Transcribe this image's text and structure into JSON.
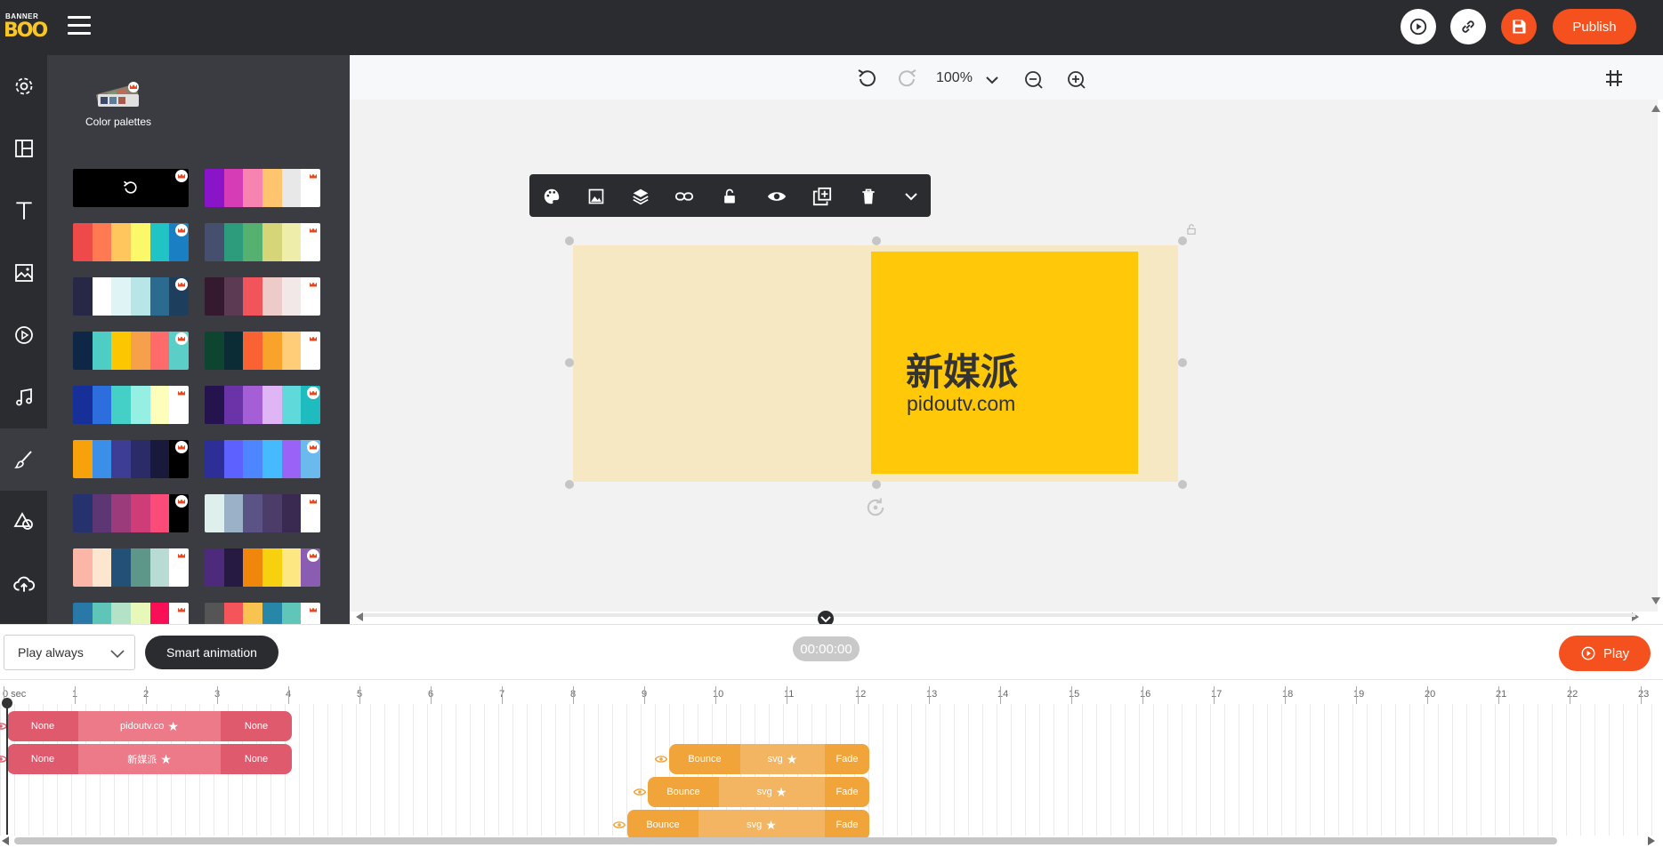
{
  "app": {
    "logo_top": "BANNER",
    "logo_bottom": "BOO",
    "publish_label": "Publish"
  },
  "panel": {
    "title": "Color palettes",
    "palettes": [
      {
        "colors": [
          "#000000"
        ],
        "is_reset": true
      },
      {
        "colors": [
          "#8a14c8",
          "#d63cb5",
          "#f783b0",
          "#ffc46e",
          "#e8e8e8",
          "#ffffff"
        ]
      },
      {
        "colors": [
          "#ef4a4a",
          "#ff7a52",
          "#ffc65d",
          "#fbf86a",
          "#21c4c4",
          "#1b7fc4"
        ]
      },
      {
        "colors": [
          "#464f6e",
          "#2c9c7d",
          "#56b06f",
          "#d6d679",
          "#eeeeaa",
          "#ffffff"
        ]
      },
      {
        "colors": [
          "#272845",
          "#ffffff",
          "#dff4f5",
          "#b8e5e8",
          "#2a6b8f",
          "#1d3e5c"
        ]
      },
      {
        "colors": [
          "#34192f",
          "#5d3a53",
          "#f2545b",
          "#edcbc9",
          "#f3e8e8",
          "#ffffff"
        ]
      },
      {
        "colors": [
          "#0f2747",
          "#4ecdc4",
          "#fcc600",
          "#f7a04b",
          "#ff6b6b",
          "#5bcec7"
        ]
      },
      {
        "colors": [
          "#0e4530",
          "#0b2c35",
          "#fa6234",
          "#f9a32a",
          "#ffcc77",
          "#ffffff"
        ]
      },
      {
        "colors": [
          "#172f98",
          "#2d6ede",
          "#45d0c7",
          "#95efe3",
          "#fdfeb9",
          "#ffffff"
        ]
      },
      {
        "colors": [
          "#24134d",
          "#6a34a8",
          "#a45fd7",
          "#e0b5f5",
          "#5fd9da",
          "#1fbcbf"
        ]
      },
      {
        "colors": [
          "#f7a10b",
          "#3c8fe8",
          "#3d3d94",
          "#2b2b68",
          "#19193b",
          "#000000"
        ]
      },
      {
        "colors": [
          "#2e2f96",
          "#5c61ff",
          "#4d86ff",
          "#45bbfe",
          "#9a62f7",
          "#6bbaee"
        ]
      },
      {
        "colors": [
          "#25326e",
          "#5d3674",
          "#9c3b7b",
          "#ce3d77",
          "#fb4c79",
          "#000000"
        ]
      },
      {
        "colors": [
          "#dff0ec",
          "#9bb1c6",
          "#5b5285",
          "#4c3c69",
          "#3a2950",
          "#ffffff"
        ]
      },
      {
        "colors": [
          "#fcb6a8",
          "#fde6cf",
          "#225077",
          "#5f968a",
          "#b8dbd3",
          "#ffffff"
        ]
      },
      {
        "colors": [
          "#4d2a7c",
          "#261a42",
          "#f0870a",
          "#f7d10f",
          "#fde783",
          "#8a5db3"
        ]
      },
      {
        "colors": [
          "#2878a8",
          "#5fc5b8",
          "#b3e2c6",
          "#e8f8b9",
          "#f90e58",
          "#ffffff"
        ]
      },
      {
        "colors": [
          "#555555",
          "#f5555a",
          "#f9c350",
          "#2687a8",
          "#5fc6b9",
          "#ffffff"
        ]
      }
    ]
  },
  "canvas": {
    "zoom": "100%",
    "headline": "新媒派",
    "url": "pidoutv.com"
  },
  "timeline": {
    "loop_select": "Play always",
    "smart_animation": "Smart animation",
    "timecode": "00:00:00",
    "play_label": "Play",
    "ticks": [
      "0 sec",
      "1",
      "2",
      "3",
      "4",
      "5",
      "6",
      "7",
      "8",
      "9",
      "10",
      "11",
      "12",
      "13",
      "14",
      "15",
      "16",
      "17",
      "18",
      "19",
      "20",
      "21",
      "22",
      "23"
    ],
    "tracks": [
      {
        "in": "None",
        "name": "pidoutv.co",
        "out": "None"
      },
      {
        "in": "None",
        "name": "新媒派",
        "out": "None"
      },
      {
        "in": "Bounce",
        "name": "svg",
        "out": "Fade"
      },
      {
        "in": "Bounce",
        "name": "svg",
        "out": "Fade"
      },
      {
        "in": "Bounce",
        "name": "svg",
        "out": "Fade"
      }
    ]
  },
  "colors": {
    "accent": "#f4511e",
    "dark": "#2b2c30",
    "banner_bg": "#f6e8c3",
    "banner_box": "#ffc90a"
  },
  "icons": {
    "rail": [
      "settings-icon",
      "layout-icon",
      "text-icon",
      "image-icon",
      "video-icon",
      "music-icon",
      "brush-icon",
      "shapes-icon",
      "upload-icon"
    ],
    "floatbar": [
      "palette-icon",
      "image-icon",
      "layers-icon",
      "link-icon",
      "unlock-icon",
      "eye-icon",
      "duplicate-icon",
      "trash-icon",
      "chevron-down-icon"
    ]
  }
}
